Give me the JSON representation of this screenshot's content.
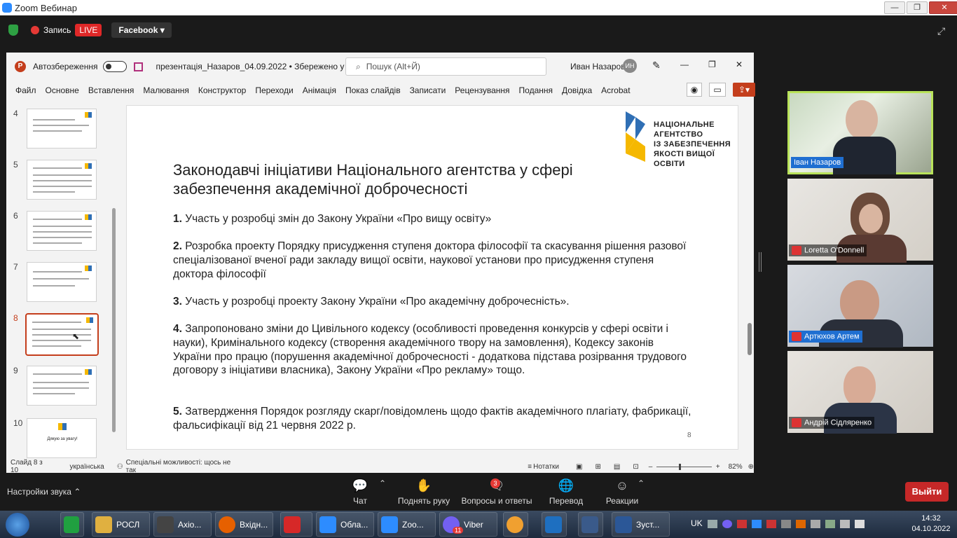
{
  "zoom": {
    "window_title": "Zoom Вебинар",
    "record_label": "Запись",
    "live_badge": "LIVE",
    "facebook_label": "Facebook"
  },
  "ppt": {
    "autosave_label": "Автозбереження",
    "file_name": "презентація_Назаров_04.09.2022 • Збережено у цей ПК",
    "search_placeholder": "Пошук (Alt+Й)",
    "user_name": "Иван Назаров",
    "user_initials": "ИН",
    "menu": [
      "Файл",
      "Основне",
      "Вставлення",
      "Малювання",
      "Конструктор",
      "Переходи",
      "Анімація",
      "Показ слайдів",
      "Записати",
      "Рецензування",
      "Подання",
      "Довідка",
      "Acrobat"
    ],
    "thumbnails": [
      {
        "num": "4"
      },
      {
        "num": "5"
      },
      {
        "num": "6"
      },
      {
        "num": "7"
      },
      {
        "num": "8"
      },
      {
        "num": "9"
      },
      {
        "num": "10",
        "text": "Дякую за увагу!"
      }
    ],
    "status": {
      "slide_info": "Слайд 8 з 10",
      "language": "українська",
      "accessibility": "Спеціальні можливості: щось не так",
      "notes": "Нотатки",
      "zoom": "82%"
    }
  },
  "slide": {
    "logo_text": [
      "НАЦІОНАЛЬНЕ",
      "АГЕНТСТВО",
      "ІЗ ЗАБЕЗПЕЧЕННЯ",
      "ЯКОСТІ ВИЩОЇ ОСВІТИ"
    ],
    "title": "Законодавчі ініціативи Національного агентства у сфері забезпечення академічної доброчесності",
    "items": [
      {
        "num": "1.",
        "text": " Участь у розробці змін до Закону України «Про вищу освіту»"
      },
      {
        "num": "2.",
        "text": " Розробка проекту Порядку присудження ступеня доктора філософії та скасування рішення разової спеціалізованої вченої ради закладу вищої освіти, наукової установи про присудження ступеня доктора філософії"
      },
      {
        "num": "3.",
        "text": " Участь у розробці проекту Закону України «Про академічну доброчесність»."
      },
      {
        "num": "4.",
        "text": " Запропоновано зміни до Цивільного кодексу (особливості проведення конкурсів у сфері освіти і науки), Кримінального кодексу (створення академічного твору на замовлення), Кодексу законів України про працю (порушення академічної доброчесності - додаткова підстава розірвання трудового договору з ініціативи власника), Закону України «Про рекламу» тощо."
      },
      {
        "num": "5.",
        "text": " Затвердження Порядок розгляду скарг/повідомлень щодо фактів академічного плагіату, фабрикації, фальсифікації від 21 червня 2022 р."
      }
    ],
    "page_number": "8"
  },
  "participants": [
    {
      "name": "Іван Назаров",
      "muted": false
    },
    {
      "name": "Loretta O'Donnell",
      "muted": true
    },
    {
      "name": "Артюхов Артем",
      "muted": true
    },
    {
      "name": "Андрій Сідляренко",
      "muted": true
    }
  ],
  "bottom": {
    "audio_settings": "Настройки звука",
    "chat": "Чат",
    "raise_hand": "Поднять руку",
    "qa": "Вопросы и ответы",
    "qa_badge": "3",
    "translate": "Перевод",
    "reactions": "Реакции",
    "leave": "Выйти"
  },
  "taskbar": {
    "items": [
      "РОСЛ",
      "Axio...",
      "Вхідн...",
      "Обла...",
      "Zoo...",
      "Viber",
      "Зуст..."
    ],
    "viber_badge": "11",
    "lang": "UK",
    "time": "14:32",
    "date": "04.10.2022"
  }
}
